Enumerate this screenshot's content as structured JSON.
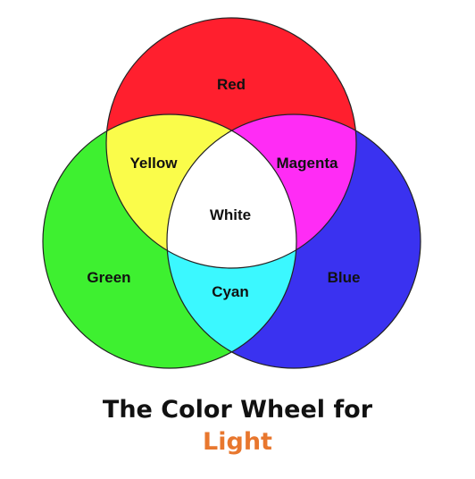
{
  "diagram": {
    "colors": {
      "red": "#ff1f2e",
      "green": "#3ef030",
      "blue": "#3a32f0",
      "yellow": "#fafc4a",
      "magenta": "#ff2cf5",
      "cyan": "#3bf8ff",
      "white": "#ffffff",
      "outline": "#222222"
    },
    "labels": {
      "red": "Red",
      "green": "Green",
      "blue": "Blue",
      "yellow": "Yellow",
      "magenta": "Magenta",
      "cyan": "Cyan",
      "white": "White"
    }
  },
  "caption": {
    "line1": "The Color Wheel for",
    "line2": "Light",
    "line2_color": "#e8772e"
  }
}
